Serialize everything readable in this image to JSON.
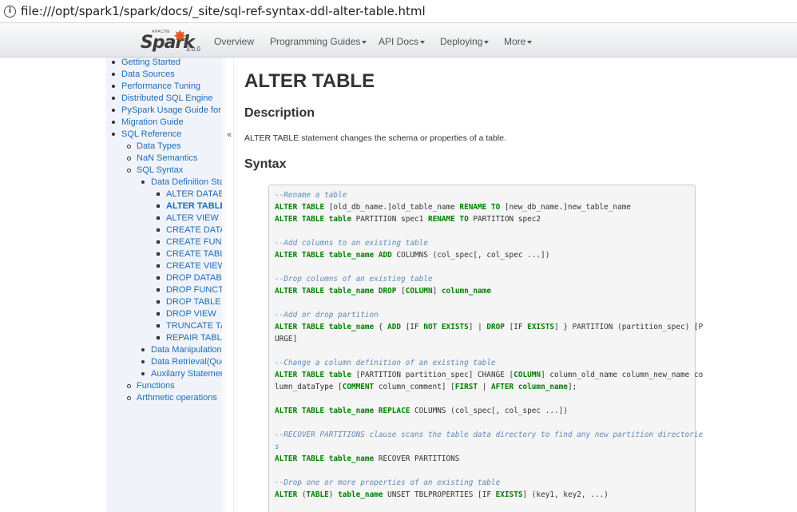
{
  "address_bar": {
    "url": "file:///opt/spark1/spark/docs/_site/sql-ref-syntax-ddl-alter-table.html"
  },
  "navbar": {
    "brand_apache": "APACHE",
    "brand_name": "Spark",
    "brand_version": "3.0.0",
    "items": [
      {
        "label": "Overview",
        "dropdown": false
      },
      {
        "label": "Programming Guides",
        "dropdown": true
      },
      {
        "label": "API Docs",
        "dropdown": true
      },
      {
        "label": "Deploying",
        "dropdown": true
      },
      {
        "label": "More",
        "dropdown": true
      }
    ]
  },
  "sidebar": {
    "items": [
      {
        "label": "Getting Started",
        "level": 1
      },
      {
        "label": "Data Sources",
        "level": 1
      },
      {
        "label": "Performance Tuning",
        "level": 1
      },
      {
        "label": "Distributed SQL Engine",
        "level": 1
      },
      {
        "label": "PySpark Usage Guide for I",
        "level": 1
      },
      {
        "label": "Migration Guide",
        "level": 1
      },
      {
        "label": "SQL Reference",
        "level": 1
      },
      {
        "label": "Data Types",
        "level": 2
      },
      {
        "label": "NaN Semantics",
        "level": 2
      },
      {
        "label": "SQL Syntax",
        "level": 2
      },
      {
        "label": "Data Definition Sta",
        "level": 3
      },
      {
        "label": "ALTER DATAB",
        "level": 4
      },
      {
        "label": "ALTER TABLE",
        "level": 4,
        "active": true
      },
      {
        "label": "ALTER VIEW",
        "level": 4
      },
      {
        "label": "CREATE DATA",
        "level": 4
      },
      {
        "label": "CREATE FUNC",
        "level": 4
      },
      {
        "label": "CREATE TABL",
        "level": 4
      },
      {
        "label": "CREATE VIEW",
        "level": 4
      },
      {
        "label": "DROP DATABA",
        "level": 4
      },
      {
        "label": "DROP FUNCT",
        "level": 4
      },
      {
        "label": "DROP TABLE",
        "level": 4
      },
      {
        "label": "DROP VIEW",
        "level": 4
      },
      {
        "label": "TRUNCATE TA",
        "level": 4
      },
      {
        "label": "REPAIR TABL",
        "level": 4
      },
      {
        "label": "Data Manipulation",
        "level": 3
      },
      {
        "label": "Data Retrieval(Que",
        "level": 3
      },
      {
        "label": "Auxilarry Statemer",
        "level": 3
      },
      {
        "label": "Functions",
        "level": 2
      },
      {
        "label": "Arthmetic operations",
        "level": 2
      }
    ],
    "collapse_glyph": "«"
  },
  "main": {
    "title": "ALTER TABLE",
    "description_heading": "Description",
    "description_text": "ALTER TABLE statement changes the schema or properties of a table.",
    "syntax_heading": "Syntax",
    "code_lines": [
      [
        {
          "t": "--Rename a table",
          "s": "c"
        }
      ],
      [
        {
          "t": "ALTER TABLE",
          "s": "k"
        },
        {
          "t": " [old_db_name.]old_table_name ",
          "s": "p"
        },
        {
          "t": "RENAME TO",
          "s": "k"
        },
        {
          "t": " [new_db_name.]new_table_name",
          "s": "p"
        }
      ],
      [
        {
          "t": "ALTER TABLE",
          "s": "k"
        },
        {
          "t": " ",
          "s": "p"
        },
        {
          "t": "table",
          "s": "k"
        },
        {
          "t": " PARTITION spec1 ",
          "s": "p"
        },
        {
          "t": "RENAME TO",
          "s": "k"
        },
        {
          "t": " PARTITION spec2",
          "s": "p"
        }
      ],
      [],
      [
        {
          "t": "--Add columns to an existing table",
          "s": "c"
        }
      ],
      [
        {
          "t": "ALTER TABLE",
          "s": "k"
        },
        {
          "t": " ",
          "s": "p"
        },
        {
          "t": "table_name",
          "s": "k"
        },
        {
          "t": " ",
          "s": "p"
        },
        {
          "t": "ADD",
          "s": "k"
        },
        {
          "t": " COLUMNS (col_spec[, col_spec ...])",
          "s": "p"
        }
      ],
      [],
      [
        {
          "t": "--Drop columns of an existing table",
          "s": "c"
        }
      ],
      [
        {
          "t": "ALTER TABLE",
          "s": "k"
        },
        {
          "t": " ",
          "s": "p"
        },
        {
          "t": "table_name",
          "s": "k"
        },
        {
          "t": " ",
          "s": "p"
        },
        {
          "t": "DROP",
          "s": "k"
        },
        {
          "t": " [",
          "s": "p"
        },
        {
          "t": "COLUMN",
          "s": "k"
        },
        {
          "t": "] ",
          "s": "p"
        },
        {
          "t": "column_name",
          "s": "k"
        }
      ],
      [],
      [
        {
          "t": "--Add or drop partition",
          "s": "c"
        }
      ],
      [
        {
          "t": "ALTER TABLE",
          "s": "k"
        },
        {
          "t": " ",
          "s": "p"
        },
        {
          "t": "table_name",
          "s": "k"
        },
        {
          "t": " { ",
          "s": "p"
        },
        {
          "t": "ADD",
          "s": "k"
        },
        {
          "t": " [IF ",
          "s": "p"
        },
        {
          "t": "NOT",
          "s": "k"
        },
        {
          "t": " ",
          "s": "p"
        },
        {
          "t": "EXISTS",
          "s": "k"
        },
        {
          "t": "] | ",
          "s": "p"
        },
        {
          "t": "DROP",
          "s": "k"
        },
        {
          "t": " [IF ",
          "s": "p"
        },
        {
          "t": "EXISTS",
          "s": "k"
        },
        {
          "t": "] } PARTITION (partition_spec) [P",
          "s": "p"
        }
      ],
      [
        {
          "t": "URGE]",
          "s": "p"
        }
      ],
      [],
      [
        {
          "t": "--Change a column definition of an existing table",
          "s": "c"
        }
      ],
      [
        {
          "t": "ALTER TABLE",
          "s": "k"
        },
        {
          "t": " ",
          "s": "p"
        },
        {
          "t": "table",
          "s": "k"
        },
        {
          "t": " [PARTITION partition_spec] CHANGE [",
          "s": "p"
        },
        {
          "t": "COLUMN",
          "s": "k"
        },
        {
          "t": "] column_old_name column_new_name co",
          "s": "p"
        }
      ],
      [
        {
          "t": "lumn_dataType [",
          "s": "p"
        },
        {
          "t": "COMMENT",
          "s": "k"
        },
        {
          "t": " column_comment] [",
          "s": "p"
        },
        {
          "t": "FIRST",
          "s": "k"
        },
        {
          "t": " | ",
          "s": "p"
        },
        {
          "t": "AFTER",
          "s": "k"
        },
        {
          "t": " ",
          "s": "p"
        },
        {
          "t": "column_name",
          "s": "k"
        },
        {
          "t": "];",
          "s": "p"
        }
      ],
      [],
      [
        {
          "t": "ALTER TABLE",
          "s": "k"
        },
        {
          "t": " ",
          "s": "p"
        },
        {
          "t": "table_name",
          "s": "k"
        },
        {
          "t": " ",
          "s": "p"
        },
        {
          "t": "REPLACE",
          "s": "k"
        },
        {
          "t": " COLUMNS (col_spec[, col_spec ...])",
          "s": "p"
        }
      ],
      [],
      [
        {
          "t": "--RECOVER PARTITIONS clause scans the table data directory to find any new partition directorie",
          "s": "c"
        }
      ],
      [
        {
          "t": "s",
          "s": "c"
        }
      ],
      [
        {
          "t": "ALTER TABLE",
          "s": "k"
        },
        {
          "t": " ",
          "s": "p"
        },
        {
          "t": "table_name",
          "s": "k"
        },
        {
          "t": " RECOVER PARTITIONS",
          "s": "p"
        }
      ],
      [],
      [
        {
          "t": "--Drop one or more properties of an existing table",
          "s": "c"
        }
      ],
      [
        {
          "t": "ALTER",
          "s": "k"
        },
        {
          "t": " (",
          "s": "p"
        },
        {
          "t": "TABLE",
          "s": "k"
        },
        {
          "t": ") ",
          "s": "p"
        },
        {
          "t": "table_name",
          "s": "k"
        },
        {
          "t": " UNSET TBLPROPERTIES [IF ",
          "s": "p"
        },
        {
          "t": "EXISTS",
          "s": "k"
        },
        {
          "t": "] (key1, key2, ...)",
          "s": "p"
        }
      ]
    ]
  }
}
